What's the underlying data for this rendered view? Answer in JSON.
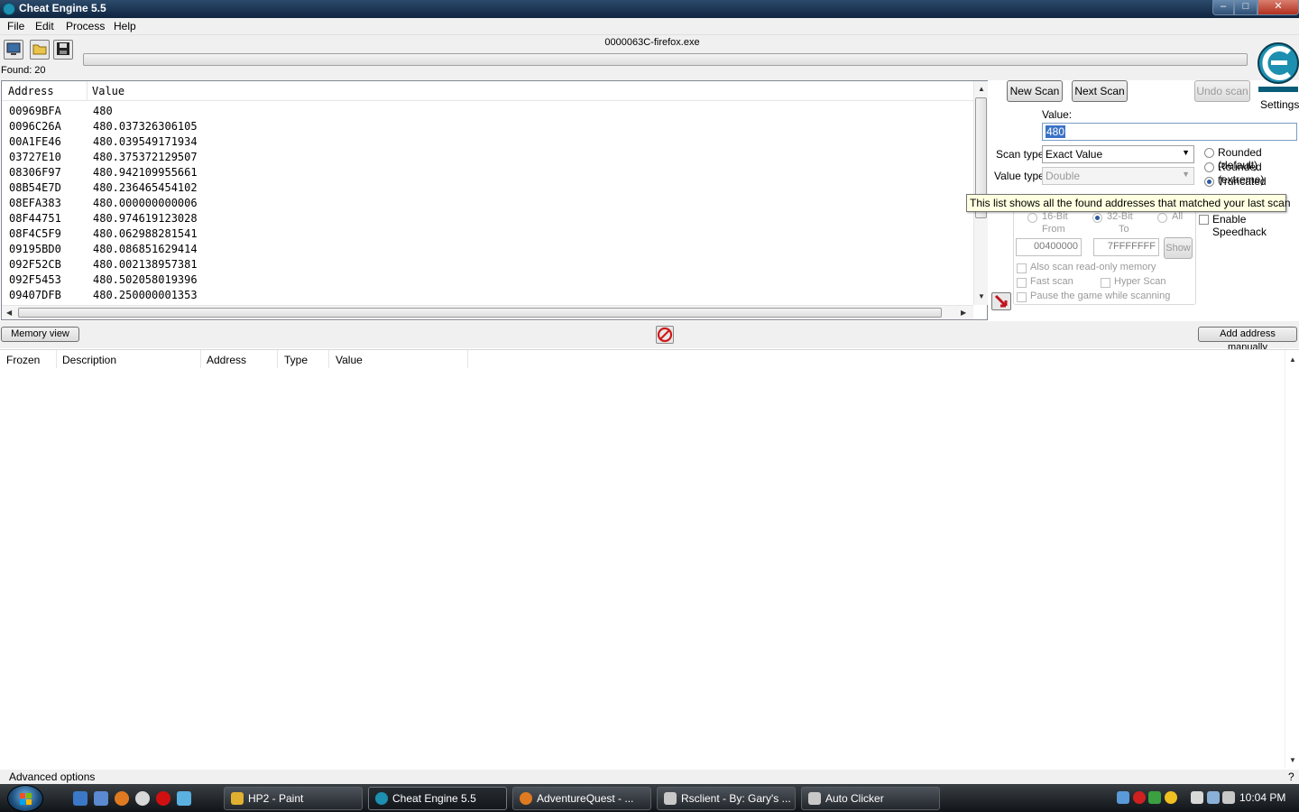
{
  "window": {
    "title": "Cheat Engine 5.5",
    "min_label": "–",
    "max_label": "□",
    "close_label": "✕"
  },
  "menu": [
    "File",
    "Edit",
    "Process",
    "Help"
  ],
  "process_title": "0000063C-firefox.exe",
  "found_label": "Found: 20",
  "found_list": {
    "headers": {
      "address": "Address",
      "value": "Value"
    },
    "rows": [
      {
        "address": "00969BFA",
        "value": "480"
      },
      {
        "address": "0096C26A",
        "value": "480.037326306105"
      },
      {
        "address": "00A1FE46",
        "value": "480.039549171934"
      },
      {
        "address": "03727E10",
        "value": "480.375372129507"
      },
      {
        "address": "08306F97",
        "value": "480.942109955661"
      },
      {
        "address": "08B54E7D",
        "value": "480.236465454102"
      },
      {
        "address": "08EFA383",
        "value": "480.000000000006"
      },
      {
        "address": "08F44751",
        "value": "480.974619123028"
      },
      {
        "address": "08F4C5F9",
        "value": "480.062988281541"
      },
      {
        "address": "09195BD0",
        "value": "480.086851629414"
      },
      {
        "address": "092F52CB",
        "value": "480.002138957381"
      },
      {
        "address": "092F5453",
        "value": "480.502058019396"
      },
      {
        "address": "09407DFB",
        "value": "480.250000001353"
      }
    ]
  },
  "scan": {
    "new_scan": "New Scan",
    "next_scan": "Next Scan",
    "undo_scan": "Undo scan",
    "settings": "Settings",
    "value_label": "Value:",
    "value": "480",
    "scan_type_label": "Scan type",
    "scan_type_value": "Exact Value",
    "value_type_label": "Value type",
    "value_type_value": "Double",
    "rounding": [
      "Rounded (default)",
      "Rounded (extreme)",
      "Truncated"
    ],
    "tooltip": "This list shows all the found addresses that matched your last scan",
    "bits": [
      "16-Bit",
      "32-Bit",
      "All"
    ],
    "from_label": "From",
    "to_label": "To",
    "from_value": "00400000",
    "to_value": "7FFFFFFF",
    "show": "Show",
    "speedhack": "Enable Speedhack",
    "readonly": "Also scan read-only memory",
    "fast": "Fast scan",
    "hyper": "Hyper Scan",
    "pause": "Pause the game while scanning"
  },
  "memory_view": "Memory view",
  "add_manual": "Add address manually",
  "address_list": {
    "headers": [
      "Frozen",
      "Description",
      "Address",
      "Type",
      "Value"
    ]
  },
  "status": {
    "advanced": "Advanced options",
    "help": "?"
  },
  "taskbar": {
    "tasks": [
      "HP2 - Paint",
      "Cheat Engine 5.5",
      "AdventureQuest - ...",
      "Rsclient - By: Gary's ...",
      "Auto Clicker"
    ],
    "clock": "10:04 PM"
  }
}
